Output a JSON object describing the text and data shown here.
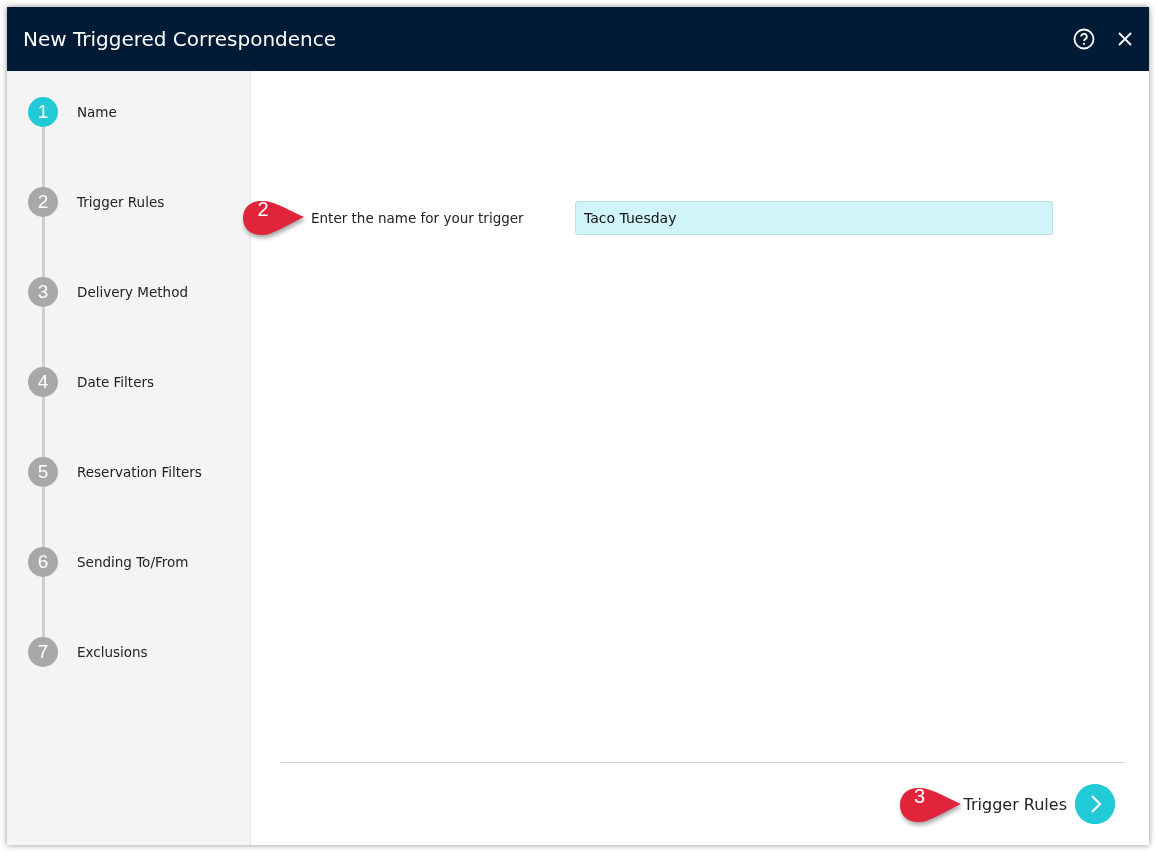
{
  "window": {
    "title": "New Triggered Correspondence"
  },
  "steps": [
    {
      "number": "1",
      "label": "Name",
      "selected": true
    },
    {
      "number": "2",
      "label": "Trigger Rules",
      "selected": false
    },
    {
      "number": "3",
      "label": "Delivery Method",
      "selected": false
    },
    {
      "number": "4",
      "label": "Date Filters",
      "selected": false
    },
    {
      "number": "5",
      "label": "Reservation Filters",
      "selected": false
    },
    {
      "number": "6",
      "label": "Sending To/From",
      "selected": false
    },
    {
      "number": "7",
      "label": "Exclusions",
      "selected": false
    }
  ],
  "name_field": {
    "callout": "2",
    "label": "Enter the name for your trigger",
    "value": "Taco Tuesday"
  },
  "next_button": {
    "callout": "3",
    "label": "Trigger Rules"
  }
}
